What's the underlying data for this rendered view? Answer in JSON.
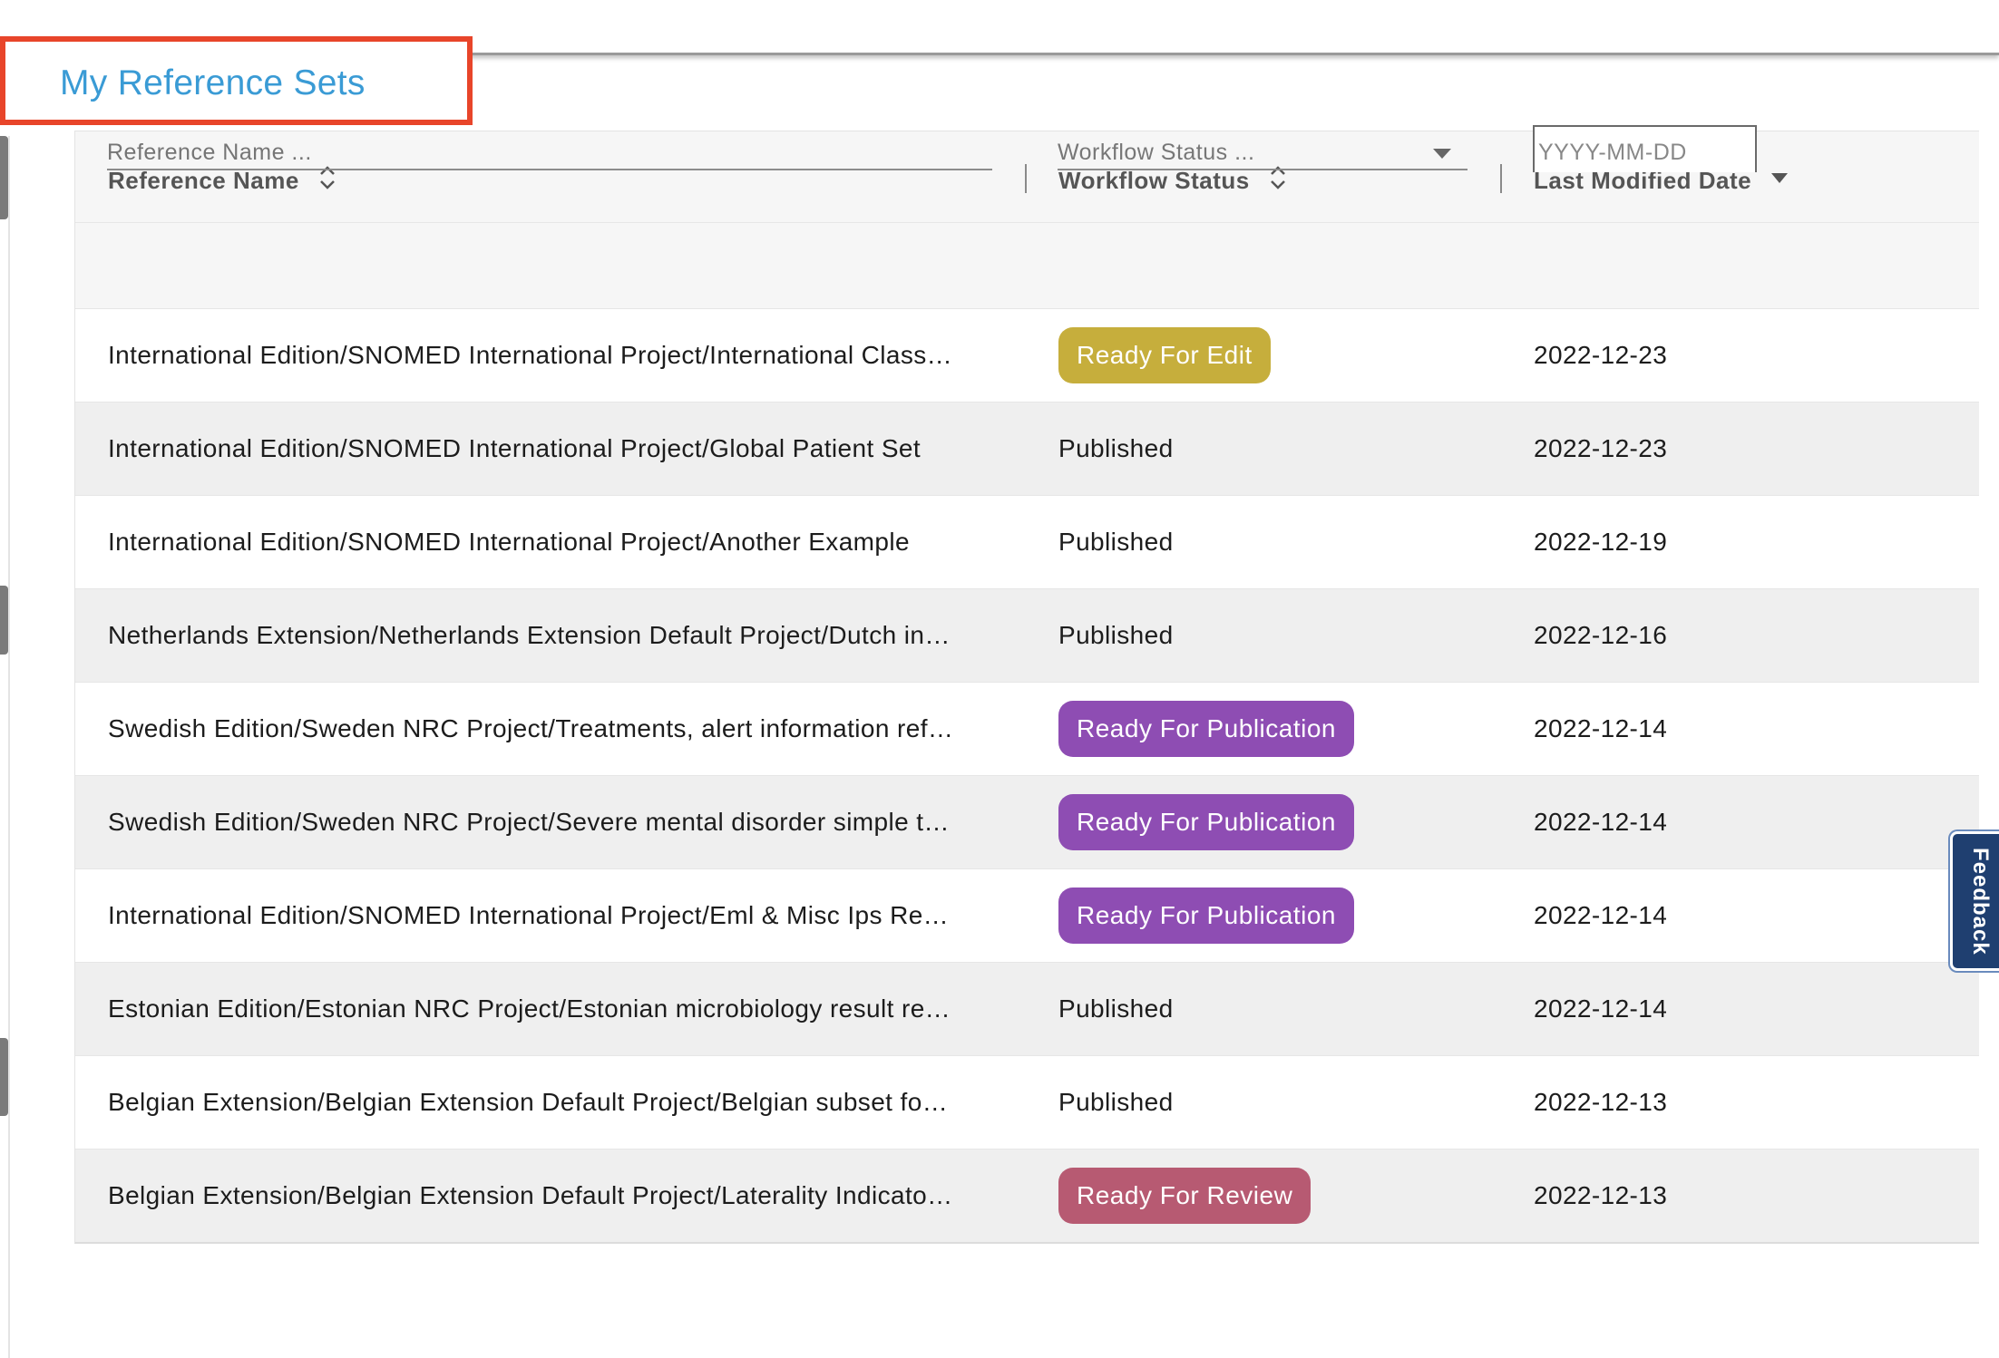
{
  "page": {
    "title": "My Reference Sets"
  },
  "table": {
    "columns": [
      {
        "label": "Reference Name",
        "sort": "sortable"
      },
      {
        "label": "Workflow Status",
        "sort": "sortable"
      },
      {
        "label": "Last Modified Date",
        "sort": "descending"
      }
    ],
    "filters": {
      "name_placeholder": "Reference Name ...",
      "status_placeholder": "Workflow Status ...",
      "date_placeholder": "YYYY-MM-DD"
    },
    "rows": [
      {
        "name": "International Edition/SNOMED International Project/International Class…",
        "status": "Ready For Edit",
        "status_type": "badge",
        "status_color": "#c6ae3c",
        "date": "2022-12-23"
      },
      {
        "name": "International Edition/SNOMED International Project/Global Patient Set",
        "status": "Published",
        "status_type": "text",
        "status_color": "",
        "date": "2022-12-23"
      },
      {
        "name": "International Edition/SNOMED International Project/Another Example",
        "status": "Published",
        "status_type": "text",
        "status_color": "",
        "date": "2022-12-19"
      },
      {
        "name": "Netherlands Extension/Netherlands Extension Default Project/Dutch in…",
        "status": "Published",
        "status_type": "text",
        "status_color": "",
        "date": "2022-12-16"
      },
      {
        "name": "Swedish Edition/Sweden NRC Project/Treatments, alert information ref…",
        "status": "Ready For Publication",
        "status_type": "badge",
        "status_color": "#8e4db3",
        "date": "2022-12-14"
      },
      {
        "name": "Swedish Edition/Sweden NRC Project/Severe mental disorder simple t…",
        "status": "Ready For Publication",
        "status_type": "badge",
        "status_color": "#8e4db3",
        "date": "2022-12-14"
      },
      {
        "name": "International Edition/SNOMED International Project/Eml & Misc Ips Re…",
        "status": "Ready For Publication",
        "status_type": "badge",
        "status_color": "#8e4db3",
        "date": "2022-12-14"
      },
      {
        "name": "Estonian Edition/Estonian NRC Project/Estonian microbiology result re…",
        "status": "Published",
        "status_type": "text",
        "status_color": "",
        "date": "2022-12-14"
      },
      {
        "name": "Belgian Extension/Belgian Extension Default Project/Belgian subset fo…",
        "status": "Published",
        "status_type": "text",
        "status_color": "",
        "date": "2022-12-13"
      },
      {
        "name": "Belgian Extension/Belgian Extension Default Project/Laterality Indicato…",
        "status": "Ready For Review",
        "status_type": "badge",
        "status_color": "#b75a72",
        "date": "2022-12-13"
      }
    ]
  },
  "feedback": {
    "label": "Feedback"
  },
  "icons": {
    "sort_icon": "sort-updown-icon",
    "sort_desc_icon": "sort-descending-icon",
    "dropdown_icon": "chevron-down-icon"
  }
}
